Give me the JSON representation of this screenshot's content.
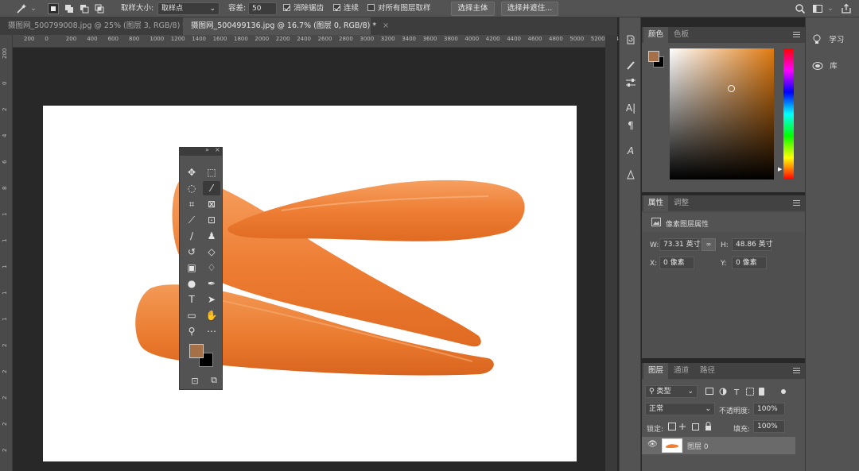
{
  "options_bar": {
    "sample_size_label": "取样大小:",
    "sample_size_value": "取样点",
    "tolerance_label": "容差:",
    "tolerance_value": "50",
    "antialias_label": "消除锯齿",
    "contiguous_label": "连续",
    "sample_all_layers_label": "对所有图层取样",
    "select_subject_button": "选择主体",
    "select_mask_button": "选择并遮住..."
  },
  "tabs": [
    {
      "label": "摄图网_500799008.jpg @ 25% (图层 3, RGB/8) *",
      "close": "×"
    },
    {
      "label": "摄图网_500499136.jpg @ 16.7% (图层 0, RGB/8) *",
      "close": "×"
    }
  ],
  "ruler_h": [
    "200",
    "0",
    "200",
    "400",
    "600",
    "800",
    "1000",
    "1200",
    "1400",
    "1600",
    "1800",
    "2000",
    "2200",
    "2400",
    "2600",
    "2800",
    "3000",
    "3200",
    "3400",
    "3600",
    "3800",
    "4000",
    "4200",
    "4400",
    "4600",
    "4800",
    "5000",
    "5200",
    "5400"
  ],
  "ruler_v": [
    "200",
    "0",
    "2",
    "4",
    "6",
    "8",
    "1",
    "1",
    "1",
    "1",
    "1",
    "2",
    "2",
    "2",
    "2",
    "2"
  ],
  "color_panel": {
    "tab_color": "颜色",
    "tab_swatches": "色板",
    "fg_color": "#a57048",
    "bg_color": "#000000",
    "hue_color": "#e07a10"
  },
  "properties_panel": {
    "tab_properties": "属性",
    "tab_adjust": "调整",
    "section_title": "像素图层属性",
    "w_label": "W:",
    "w_value": "73.31 英寸",
    "h_label": "H:",
    "h_value": "48.86 英寸",
    "x_label": "X:",
    "x_value": "0 像素",
    "y_label": "Y:",
    "y_value": "0 像素"
  },
  "layers_panel": {
    "tab_layers": "图层",
    "tab_channels": "通道",
    "tab_paths": "路径",
    "filter_label": "类型",
    "blend_mode": "正常",
    "opacity_label": "不透明度:",
    "opacity_value": "100%",
    "lock_label": "锁定:",
    "fill_label": "填充:",
    "fill_value": "100%",
    "layer_name": "图层 0"
  },
  "right_dock": {
    "learn_label": "学习",
    "library_label": "库"
  },
  "tool_colors": {
    "fg": "#a57048",
    "bg": "#000000"
  }
}
